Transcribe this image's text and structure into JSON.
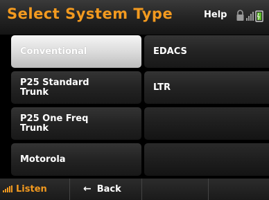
{
  "header": {
    "title": "Select System Type",
    "help_label": "Help",
    "status_icons": [
      "lock-icon",
      "signal-bars-icon",
      "battery-icon"
    ]
  },
  "system_types": {
    "left": [
      {
        "label": "Conventional",
        "selected": true
      },
      {
        "label": "P25 Standard Trunk",
        "selected": false
      },
      {
        "label": "P25 One Freq Trunk",
        "selected": false
      },
      {
        "label": "Motorola",
        "selected": false
      }
    ],
    "right": [
      {
        "label": "EDACS",
        "selected": false
      },
      {
        "label": "LTR",
        "selected": false
      },
      {
        "label": "",
        "selected": false
      },
      {
        "label": "",
        "selected": false
      }
    ]
  },
  "footer": {
    "listen_label": "Listen",
    "back_label": "Back",
    "listen_icon": "signal-bars-icon",
    "back_icon": "arrow-left-icon"
  },
  "colors": {
    "accent": "#f39a1f",
    "text": "#ffffff",
    "selected_bg": "#d9d9d9",
    "button_bg": "#232323"
  }
}
